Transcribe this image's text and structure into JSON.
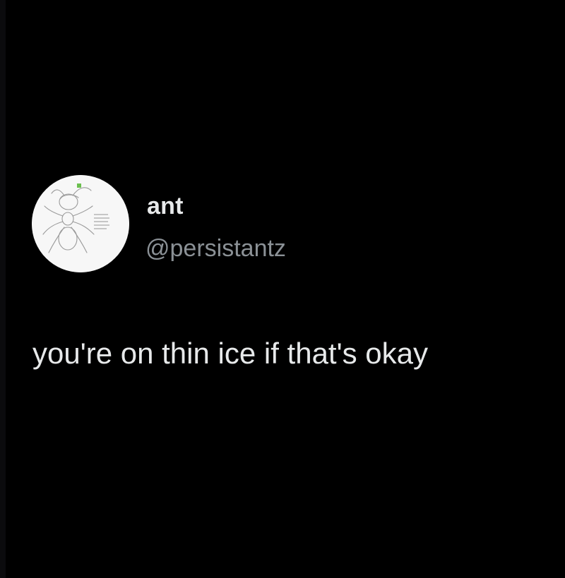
{
  "tweet": {
    "author": {
      "display_name": "ant",
      "handle": "@persistantz",
      "avatar_icon": "ant-sketch-avatar"
    },
    "text": "you're on thin ice if that's okay"
  },
  "colors": {
    "background": "#000000",
    "primary_text": "#e7e9ea",
    "secondary_text": "#8b9196",
    "avatar_background": "#f7f7f7"
  }
}
